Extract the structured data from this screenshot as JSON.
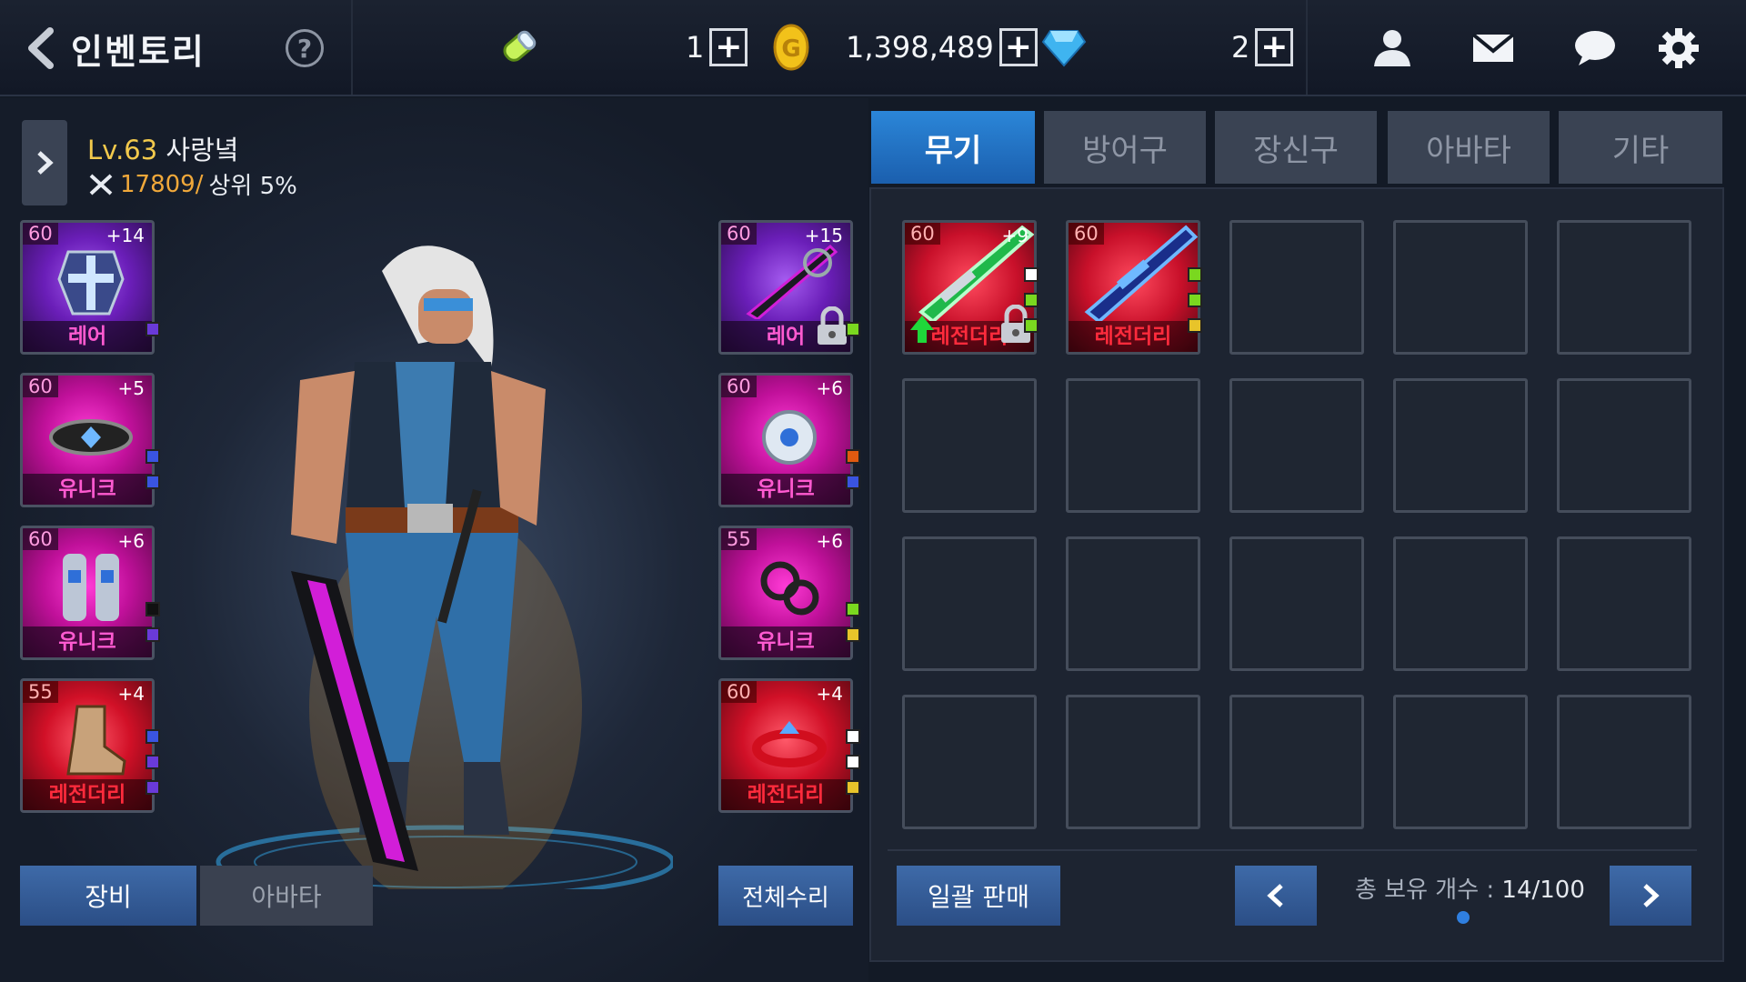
{
  "header": {
    "title": "인벤토리",
    "help_label": "?",
    "energy_count": "1",
    "gold": "1,398,489",
    "gems": "2",
    "plus_label": "+"
  },
  "character": {
    "level": "Lv.63",
    "name": "사랑녘",
    "power": "17809/",
    "rank": "상위 5%"
  },
  "equipped_left": [
    {
      "level": "60",
      "enhance": "+14",
      "grade": "레어",
      "type": "rare",
      "icon": "armor-icon",
      "gems": [
        "#6a3ad8"
      ]
    },
    {
      "level": "60",
      "enhance": "+5",
      "grade": "유니크",
      "type": "unique",
      "icon": "belt-icon",
      "gems": [
        "#3a54e0",
        "#3a54e0"
      ]
    },
    {
      "level": "60",
      "enhance": "+6",
      "grade": "유니크",
      "type": "unique",
      "icon": "leggings-icon",
      "gems": [
        "#111111",
        "#6a3ad8"
      ]
    },
    {
      "level": "55",
      "enhance": "+4",
      "grade": "레전더리",
      "type": "legend",
      "icon": "boots-icon",
      "gems": [
        "#3a54e0",
        "#6a3ad8",
        "#6a3ad8"
      ]
    }
  ],
  "equipped_right": [
    {
      "level": "60",
      "enhance": "+15",
      "grade": "레어",
      "type": "rare",
      "icon": "greatsword-icon",
      "gems": [
        "#7ad81f"
      ],
      "locked": true
    },
    {
      "level": "60",
      "enhance": "+6",
      "grade": "유니크",
      "type": "unique",
      "icon": "necklace-icon",
      "gems": [
        "#e05a10",
        "#3a54e0"
      ]
    },
    {
      "level": "55",
      "enhance": "+6",
      "grade": "유니크",
      "type": "unique",
      "icon": "earring-icon",
      "gems": [
        "#7ad81f",
        "#e8c42a"
      ]
    },
    {
      "level": "60",
      "enhance": "+4",
      "grade": "레전더리",
      "type": "legend",
      "icon": "ring-icon",
      "gems": [
        "#ffffff",
        "#ffffff",
        "#e8c42a"
      ]
    }
  ],
  "buttons": {
    "equip": "장비",
    "avatar": "아바타",
    "repair_all": "전체수리",
    "bulk_sell": "일괄 판매"
  },
  "tabs": [
    "무기",
    "방어구",
    "장신구",
    "아바타",
    "기타"
  ],
  "inventory_items": [
    {
      "level": "60",
      "enhance": "+9",
      "grade": "레전더리",
      "icon": "green-sword-icon",
      "gems": [
        "#ffffff",
        "#7ad81f",
        "#7ad81f"
      ],
      "locked": true,
      "upgrade": true
    },
    {
      "level": "60",
      "enhance": "",
      "grade": "레전더리",
      "icon": "blue-sword-icon",
      "gems": [
        "#7ad81f",
        "#7ad81f",
        "#e8c42a"
      ],
      "locked": false,
      "upgrade": false
    }
  ],
  "inventory": {
    "count_label": "총 보유 개수 : ",
    "count_value": "14/100"
  },
  "colors": {
    "active_tab": "#1f6fc2",
    "gold": "#f2c94c",
    "unique": "#ff3bd6",
    "rare": "#8a3ee0",
    "legendary": "#e0142f"
  }
}
